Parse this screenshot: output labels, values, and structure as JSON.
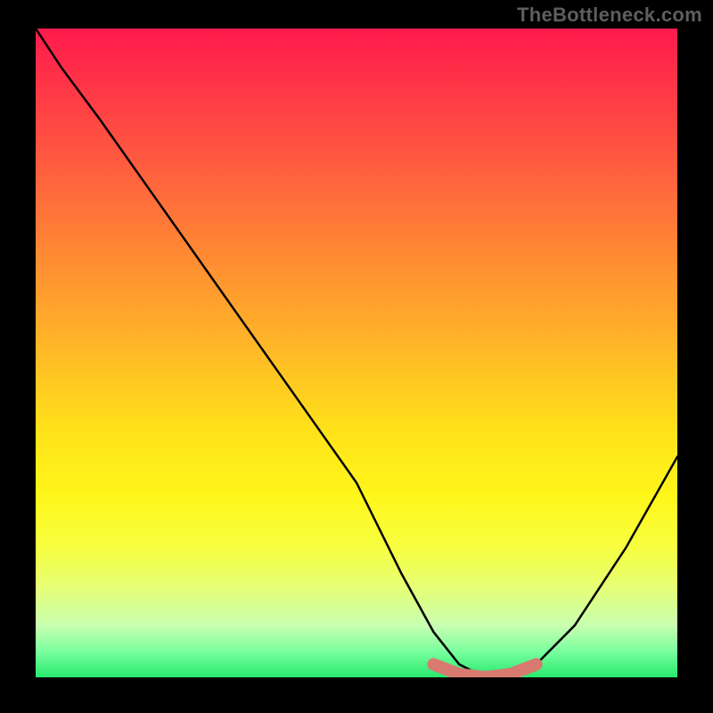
{
  "watermark": "TheBottleneck.com",
  "chart_data": {
    "type": "line",
    "title": "",
    "xlabel": "",
    "ylabel": "",
    "xlim": [
      0,
      100
    ],
    "ylim": [
      0,
      100
    ],
    "series": [
      {
        "name": "bottleneck-curve",
        "x": [
          0,
          4,
          10,
          20,
          30,
          40,
          50,
          57,
          62,
          66,
          70,
          74,
          78,
          84,
          92,
          100
        ],
        "y": [
          100,
          94,
          86,
          72,
          58,
          44,
          30,
          16,
          7,
          2,
          0,
          0,
          2,
          8,
          20,
          34
        ]
      }
    ],
    "highlight": {
      "name": "valley-floor",
      "x": [
        62,
        66,
        70,
        74,
        78
      ],
      "y": [
        2,
        0.5,
        0,
        0.5,
        2
      ],
      "color": "#d87a70"
    }
  },
  "colors": {
    "curve": "#000000",
    "highlight": "#d87a70",
    "background_top": "#ff1a4d",
    "background_bottom": "#27e86f",
    "frame": "#000000"
  }
}
